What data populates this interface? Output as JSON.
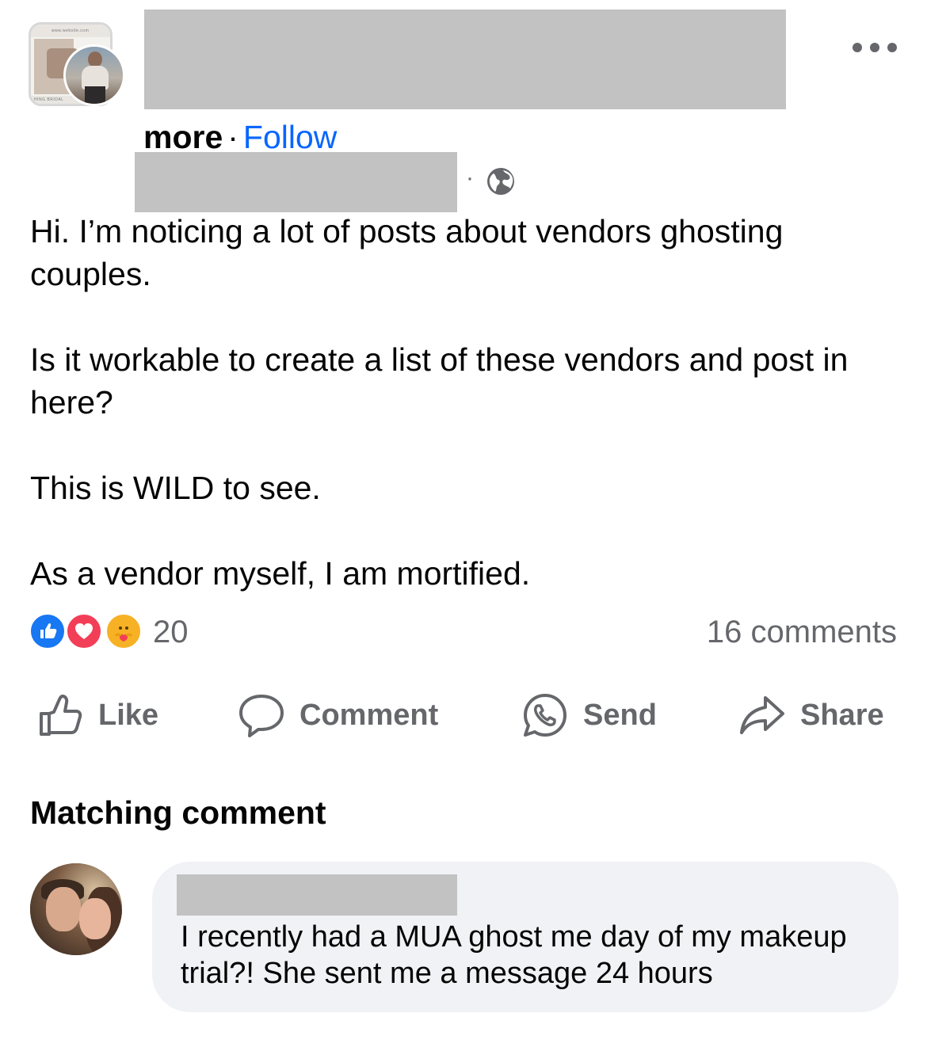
{
  "header": {
    "more_label": "more",
    "separator": "·",
    "follow_label": "Follow",
    "meta_separator": "·",
    "privacy_icon": "globe-icon",
    "menu_icon": "ellipsis-icon",
    "group_avatar_caption_top": "www.website.com",
    "group_avatar_caption_bottom": "HING BRIDAL"
  },
  "post": {
    "paragraphs": [
      "Hi. I’m noticing a lot of posts about vendors ghosting couples.",
      "Is it workable to create a list of these vendors and post in here?",
      "This is WILD to see.",
      "As a vendor myself, I am mortified."
    ]
  },
  "reactions": {
    "icons": [
      "like-reaction-icon",
      "love-reaction-icon",
      "care-reaction-icon"
    ],
    "count": "20",
    "comments": "16 comments"
  },
  "actions": [
    {
      "label": "Like",
      "icon": "thumbs-up-icon"
    },
    {
      "label": "Comment",
      "icon": "comment-bubble-icon"
    },
    {
      "label": "Send",
      "icon": "whatsapp-icon"
    },
    {
      "label": "Share",
      "icon": "share-arrow-icon"
    }
  ],
  "matching": {
    "title": "Matching comment",
    "comment_text": "I recently had a MUA ghost me day of my makeup trial?! She sent me a message 24 hours"
  },
  "colors": {
    "link": "#0866ff",
    "secondary_text": "#65676b",
    "bubble": "#f0f2f5",
    "redaction": "#c2c2c2"
  }
}
